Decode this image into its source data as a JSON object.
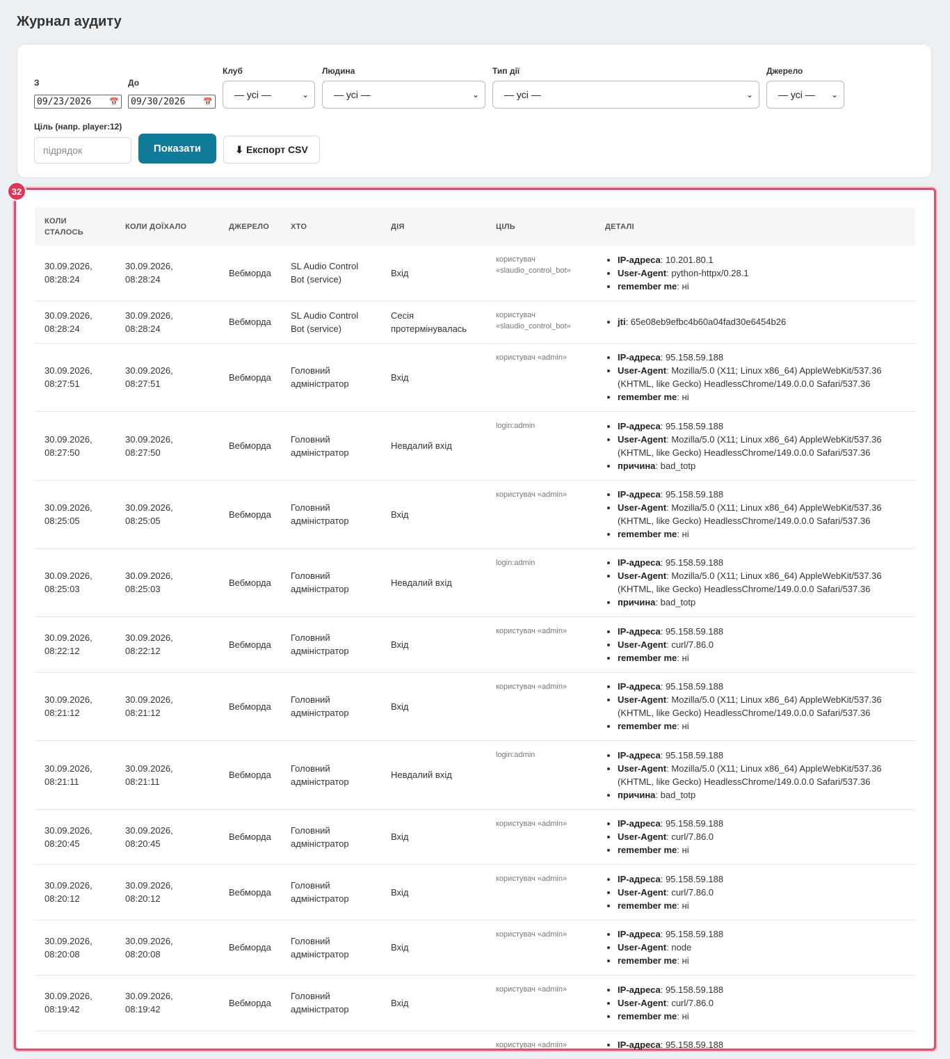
{
  "page": {
    "title": "Журнал аудиту"
  },
  "filters": {
    "from_label": "З",
    "from_value": "09/23/2026",
    "to_label": "До",
    "to_value": "09/30/2026",
    "club_label": "Клуб",
    "club_value": "— усі —",
    "person_label": "Людина",
    "person_value": "— усі —",
    "action_label": "Тип дії",
    "action_value": "— усі —",
    "source_label": "Джерело",
    "source_value": "— усі —",
    "target_label": "Ціль (напр. player:12)",
    "target_placeholder": "підрядок",
    "show_button": "Показати",
    "export_button": "Експорт CSV",
    "export_icon": "download-arrow-icon"
  },
  "badge": "32",
  "table": {
    "headers": [
      "Коли сталось",
      "Коли доїхало",
      "Джерело",
      "Хто",
      "Дія",
      "Ціль",
      "Деталі"
    ],
    "rows": [
      {
        "happened": "30.09.2026, 08:28:24",
        "arrived": "30.09.2026, 08:28:24",
        "source": "Вебморда",
        "who": "SL Audio Control Bot (service)",
        "action": "Вхід",
        "target": "користувач «slaudio_control_bot»",
        "details": [
          {
            "k": "IP-адреса",
            "v": "10.201.80.1"
          },
          {
            "k": "User-Agent",
            "v": "python-httpx/0.28.1"
          },
          {
            "k": "remember me",
            "v": "ні"
          }
        ]
      },
      {
        "happened": "30.09.2026, 08:28:24",
        "arrived": "30.09.2026, 08:28:24",
        "source": "Вебморда",
        "who": "SL Audio Control Bot (service)",
        "action": "Сесія протермінувалась",
        "target": "користувач «slaudio_control_bot»",
        "details": [
          {
            "k": "jti",
            "v": "65e08eb9efbc4b60a04fad30e6454b26"
          }
        ]
      },
      {
        "happened": "30.09.2026, 08:27:51",
        "arrived": "30.09.2026, 08:27:51",
        "source": "Вебморда",
        "who": "Головний адміністратор",
        "action": "Вхід",
        "target": "користувач «admin»",
        "details": [
          {
            "k": "IP-адреса",
            "v": "95.158.59.188"
          },
          {
            "k": "User-Agent",
            "v": "Mozilla/5.0 (X11; Linux x86_64) AppleWebKit/537.36 (KHTML, like Gecko) HeadlessChrome/149.0.0.0 Safari/537.36"
          },
          {
            "k": "remember me",
            "v": "ні"
          }
        ]
      },
      {
        "happened": "30.09.2026, 08:27:50",
        "arrived": "30.09.2026, 08:27:50",
        "source": "Вебморда",
        "who": "Головний адміністратор",
        "action": "Невдалий вхід",
        "target": "login:admin",
        "details": [
          {
            "k": "IP-адреса",
            "v": "95.158.59.188"
          },
          {
            "k": "User-Agent",
            "v": "Mozilla/5.0 (X11; Linux x86_64) AppleWebKit/537.36 (KHTML, like Gecko) HeadlessChrome/149.0.0.0 Safari/537.36"
          },
          {
            "k": "причина",
            "v": "bad_totp"
          }
        ]
      },
      {
        "happened": "30.09.2026, 08:25:05",
        "arrived": "30.09.2026, 08:25:05",
        "source": "Вебморда",
        "who": "Головний адміністратор",
        "action": "Вхід",
        "target": "користувач «admin»",
        "details": [
          {
            "k": "IP-адреса",
            "v": "95.158.59.188"
          },
          {
            "k": "User-Agent",
            "v": "Mozilla/5.0 (X11; Linux x86_64) AppleWebKit/537.36 (KHTML, like Gecko) HeadlessChrome/149.0.0.0 Safari/537.36"
          },
          {
            "k": "remember me",
            "v": "ні"
          }
        ]
      },
      {
        "happened": "30.09.2026, 08:25:03",
        "arrived": "30.09.2026, 08:25:03",
        "source": "Вебморда",
        "who": "Головний адміністратор",
        "action": "Невдалий вхід",
        "target": "login:admin",
        "details": [
          {
            "k": "IP-адреса",
            "v": "95.158.59.188"
          },
          {
            "k": "User-Agent",
            "v": "Mozilla/5.0 (X11; Linux x86_64) AppleWebKit/537.36 (KHTML, like Gecko) HeadlessChrome/149.0.0.0 Safari/537.36"
          },
          {
            "k": "причина",
            "v": "bad_totp"
          }
        ]
      },
      {
        "happened": "30.09.2026, 08:22:12",
        "arrived": "30.09.2026, 08:22:12",
        "source": "Вебморда",
        "who": "Головний адміністратор",
        "action": "Вхід",
        "target": "користувач «admin»",
        "details": [
          {
            "k": "IP-адреса",
            "v": "95.158.59.188"
          },
          {
            "k": "User-Agent",
            "v": "curl/7.86.0"
          },
          {
            "k": "remember me",
            "v": "ні"
          }
        ]
      },
      {
        "happened": "30.09.2026, 08:21:12",
        "arrived": "30.09.2026, 08:21:12",
        "source": "Вебморда",
        "who": "Головний адміністратор",
        "action": "Вхід",
        "target": "користувач «admin»",
        "details": [
          {
            "k": "IP-адреса",
            "v": "95.158.59.188"
          },
          {
            "k": "User-Agent",
            "v": "Mozilla/5.0 (X11; Linux x86_64) AppleWebKit/537.36 (KHTML, like Gecko) HeadlessChrome/149.0.0.0 Safari/537.36"
          },
          {
            "k": "remember me",
            "v": "ні"
          }
        ]
      },
      {
        "happened": "30.09.2026, 08:21:11",
        "arrived": "30.09.2026, 08:21:11",
        "source": "Вебморда",
        "who": "Головний адміністратор",
        "action": "Невдалий вхід",
        "target": "login:admin",
        "details": [
          {
            "k": "IP-адреса",
            "v": "95.158.59.188"
          },
          {
            "k": "User-Agent",
            "v": "Mozilla/5.0 (X11; Linux x86_64) AppleWebKit/537.36 (KHTML, like Gecko) HeadlessChrome/149.0.0.0 Safari/537.36"
          },
          {
            "k": "причина",
            "v": "bad_totp"
          }
        ]
      },
      {
        "happened": "30.09.2026, 08:20:45",
        "arrived": "30.09.2026, 08:20:45",
        "source": "Вебморда",
        "who": "Головний адміністратор",
        "action": "Вхід",
        "target": "користувач «admin»",
        "details": [
          {
            "k": "IP-адреса",
            "v": "95.158.59.188"
          },
          {
            "k": "User-Agent",
            "v": "curl/7.86.0"
          },
          {
            "k": "remember me",
            "v": "ні"
          }
        ]
      },
      {
        "happened": "30.09.2026, 08:20:12",
        "arrived": "30.09.2026, 08:20:12",
        "source": "Вебморда",
        "who": "Головний адміністратор",
        "action": "Вхід",
        "target": "користувач «admin»",
        "details": [
          {
            "k": "IP-адреса",
            "v": "95.158.59.188"
          },
          {
            "k": "User-Agent",
            "v": "curl/7.86.0"
          },
          {
            "k": "remember me",
            "v": "ні"
          }
        ]
      },
      {
        "happened": "30.09.2026, 08:20:08",
        "arrived": "30.09.2026, 08:20:08",
        "source": "Вебморда",
        "who": "Головний адміністратор",
        "action": "Вхід",
        "target": "користувач «admin»",
        "details": [
          {
            "k": "IP-адреса",
            "v": "95.158.59.188"
          },
          {
            "k": "User-Agent",
            "v": "node"
          },
          {
            "k": "remember me",
            "v": "ні"
          }
        ]
      },
      {
        "happened": "30.09.2026, 08:19:42",
        "arrived": "30.09.2026, 08:19:42",
        "source": "Вебморда",
        "who": "Головний адміністратор",
        "action": "Вхід",
        "target": "користувач «admin»",
        "details": [
          {
            "k": "IP-адреса",
            "v": "95.158.59.188"
          },
          {
            "k": "User-Agent",
            "v": "curl/7.86.0"
          },
          {
            "k": "remember me",
            "v": "ні"
          }
        ]
      },
      {
        "happened": "",
        "arrived": "",
        "source": "",
        "who": "",
        "action": "",
        "target": "користувач «admin»",
        "details": [
          {
            "k": "IP-адреса",
            "v": "95.158.59.188"
          }
        ]
      }
    ]
  }
}
